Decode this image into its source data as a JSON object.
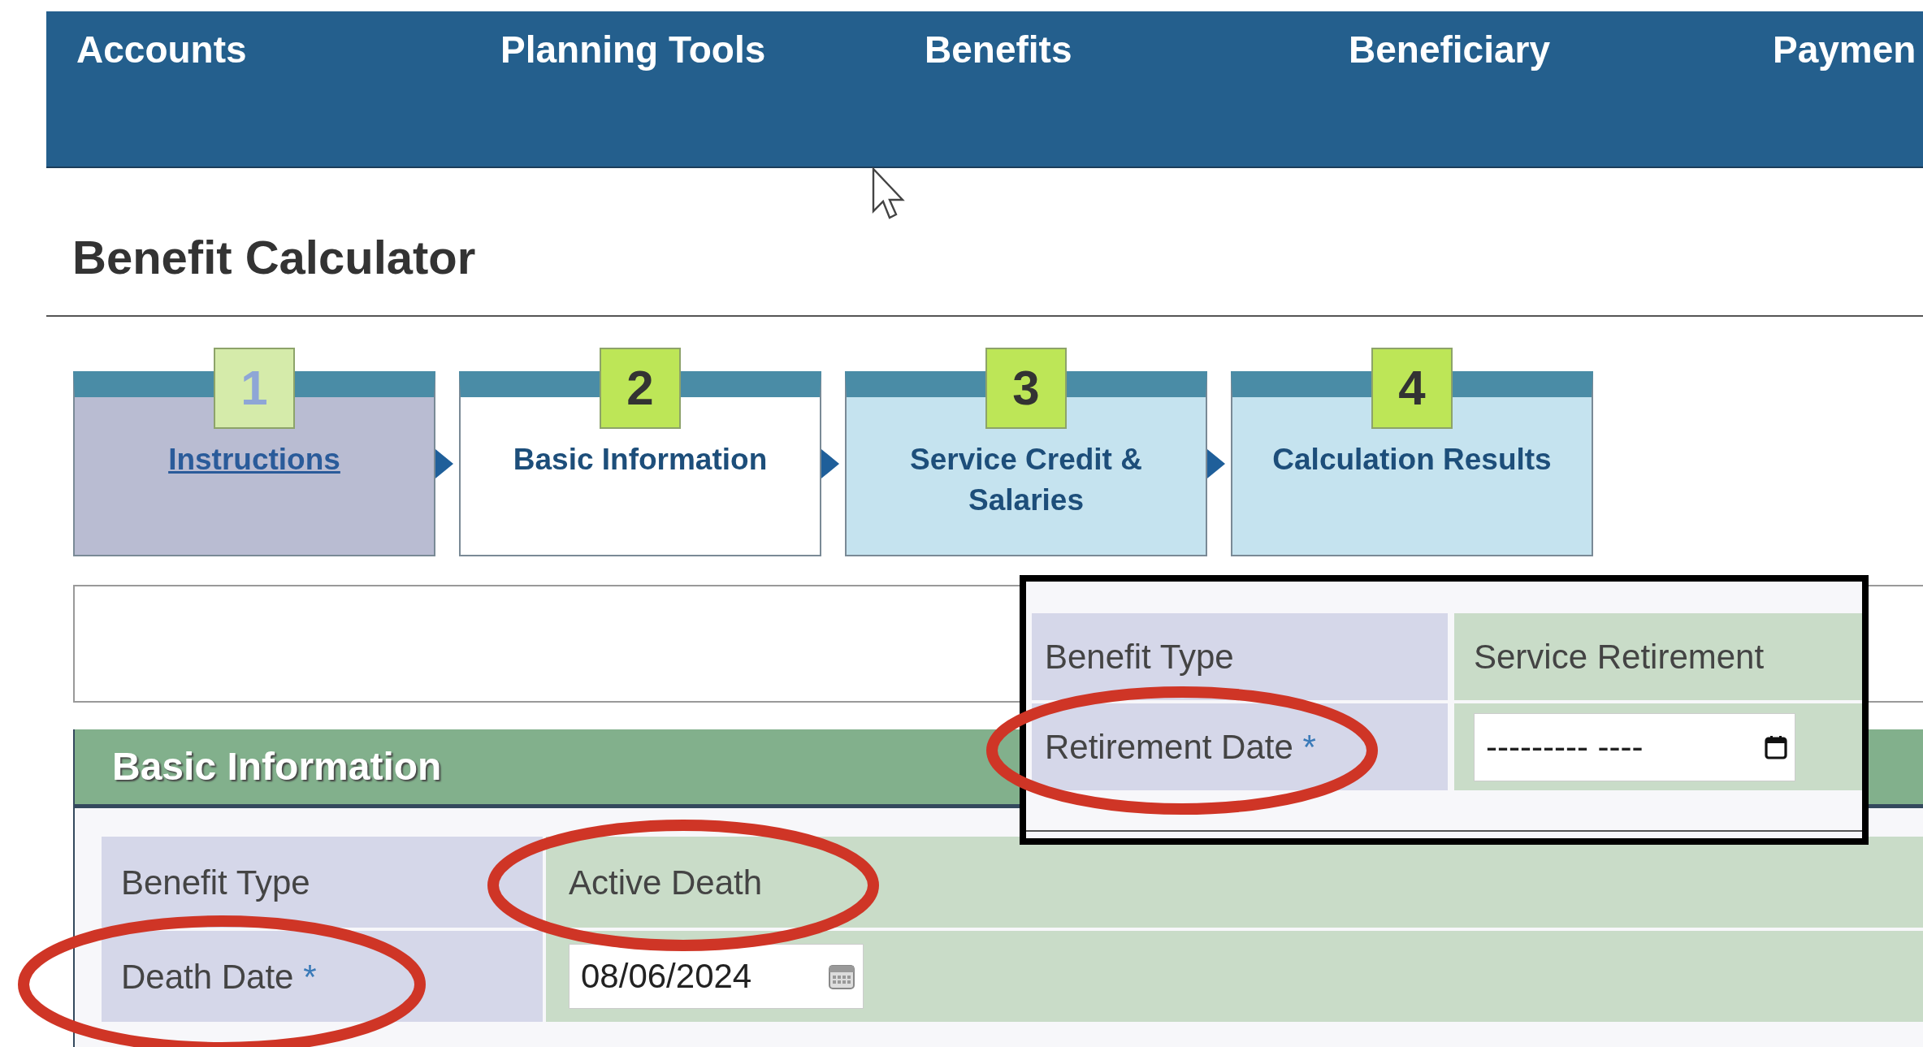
{
  "nav": {
    "items": [
      {
        "label": "Accounts"
      },
      {
        "label": "Planning Tools"
      },
      {
        "label": "Benefits"
      },
      {
        "label": "Beneficiary"
      },
      {
        "label": "Paymen"
      }
    ]
  },
  "page_title": "Benefit Calculator",
  "steps": [
    {
      "number": "1",
      "label": "Instructions",
      "visited": true,
      "selected": false
    },
    {
      "number": "2",
      "label": "Basic Information",
      "visited": false,
      "selected": true
    },
    {
      "number": "3",
      "label": "Service Credit & Salaries",
      "visited": false,
      "selected": false
    },
    {
      "number": "4",
      "label": "Calculation Results",
      "visited": false,
      "selected": false
    }
  ],
  "panel": {
    "title": "Basic Information",
    "rows": [
      {
        "kind": "text",
        "label": "Benefit Type",
        "value": "Active Death"
      },
      {
        "kind": "date",
        "label": "Death Date",
        "required_mark": "*",
        "value": "08/06/2024"
      }
    ]
  },
  "inset": {
    "rows": [
      {
        "kind": "text",
        "label": "Benefit Type",
        "value": "Service Retirement"
      },
      {
        "kind": "native-date",
        "label": "Retirement Date",
        "required_mark": "*",
        "value": "--------- ----"
      }
    ]
  }
}
